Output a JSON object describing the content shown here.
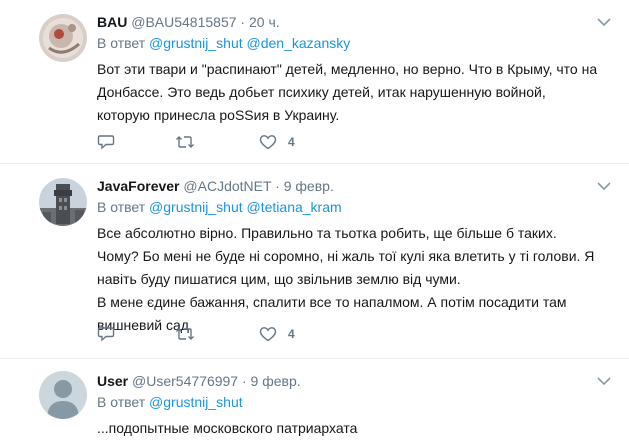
{
  "tweets": [
    {
      "name": "BAU",
      "handle": "@BAU54815857",
      "separator": "·",
      "time": "20 ч.",
      "reply_prefix": "В ответ",
      "mentions": [
        "@grustnij_shut",
        "@den_kazansky"
      ],
      "lines": [
        "Вот эти твари и \"распинают\" детей, медленно, но верно. Что в Крыму, что на",
        "Донбассе. Это ведь добьет психику детей, итак нарушенную войной,",
        "которую принесла poSSия в Украину."
      ],
      "likes": "4"
    },
    {
      "name": "JavaForever",
      "handle": "@ACJdotNET",
      "separator": "·",
      "time": "9 февр.",
      "reply_prefix": "В ответ",
      "mentions": [
        "@grustnij_shut",
        "@tetiana_kram"
      ],
      "lines": [
        "Все абсолютно вірно. Правильно та тьотка робить, ще більше б таких.",
        "Чому? Бо мені не буде ні соромно, ні жаль тої кулі яка влетить у ті голови. Я",
        "навіть буду пишатися цим, що звільнив землю від чуми.",
        "В мене єдине бажання, спалити все то напалмом. А потім посадити там",
        "вишневий сад"
      ],
      "likes": "4"
    },
    {
      "name": "User",
      "handle": "@User54776997",
      "separator": "·",
      "time": "9 февр.",
      "reply_prefix": "В ответ",
      "mentions": [
        "@grustnij_shut"
      ],
      "lines": [
        "...подопытные московского патриархата"
      ]
    }
  ],
  "colors": {
    "link": "#1b95e0",
    "muted": "#657786",
    "divider": "#e6ecf0"
  },
  "icons": [
    "reply-icon",
    "retweet-icon",
    "like-icon",
    "caret-down-icon"
  ]
}
